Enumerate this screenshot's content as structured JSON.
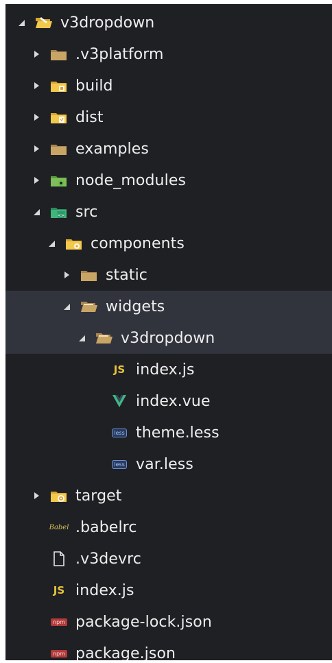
{
  "tree": [
    {
      "label": "v3dropdown",
      "depth": 0,
      "arrow": "expanded",
      "icon": "folder-open-yellow-icon"
    },
    {
      "label": ".v3platform",
      "depth": 1,
      "arrow": "collapsed",
      "icon": "folder-tan-icon"
    },
    {
      "label": "build",
      "depth": 1,
      "arrow": "collapsed",
      "icon": "folder-build-icon"
    },
    {
      "label": "dist",
      "depth": 1,
      "arrow": "collapsed",
      "icon": "folder-dist-icon"
    },
    {
      "label": "examples",
      "depth": 1,
      "arrow": "collapsed",
      "icon": "folder-tan-icon"
    },
    {
      "label": "node_modules",
      "depth": 1,
      "arrow": "collapsed",
      "icon": "folder-node-icon"
    },
    {
      "label": "src",
      "depth": 1,
      "arrow": "expanded",
      "icon": "folder-src-icon"
    },
    {
      "label": "components",
      "depth": 2,
      "arrow": "expanded",
      "icon": "folder-components-icon"
    },
    {
      "label": "static",
      "depth": 3,
      "arrow": "collapsed",
      "icon": "folder-tan-icon"
    },
    {
      "label": "widgets",
      "depth": 3,
      "arrow": "expanded",
      "icon": "folder-open-tan-icon",
      "highlight": true
    },
    {
      "label": "v3dropdown",
      "depth": 4,
      "arrow": "expanded",
      "icon": "folder-open-tan-icon",
      "highlight": true
    },
    {
      "label": "index.js",
      "depth": 5,
      "arrow": "none",
      "icon": "js-file-icon",
      "icon_text": "JS"
    },
    {
      "label": "index.vue",
      "depth": 5,
      "arrow": "none",
      "icon": "vue-file-icon"
    },
    {
      "label": "theme.less",
      "depth": 5,
      "arrow": "none",
      "icon": "less-file-icon",
      "icon_text": "less"
    },
    {
      "label": "var.less",
      "depth": 5,
      "arrow": "none",
      "icon": "less-file-icon",
      "icon_text": "less"
    },
    {
      "label": "target",
      "depth": 1,
      "arrow": "collapsed",
      "icon": "folder-target-icon"
    },
    {
      "label": ".babelrc",
      "depth": 1,
      "arrow": "none",
      "icon": "babel-file-icon",
      "icon_text": "Babel"
    },
    {
      "label": ".v3devrc",
      "depth": 1,
      "arrow": "none",
      "icon": "file-icon"
    },
    {
      "label": "index.js",
      "depth": 1,
      "arrow": "none",
      "icon": "js-file-icon",
      "icon_text": "JS"
    },
    {
      "label": "package-lock.json",
      "depth": 1,
      "arrow": "none",
      "icon": "npm-file-icon",
      "icon_text": "npm"
    },
    {
      "label": "package.json",
      "depth": 1,
      "arrow": "none",
      "icon": "npm-file-icon",
      "icon_text": "npm"
    }
  ],
  "colors": {
    "background": "#1f2024",
    "highlight_row": "#32343d",
    "text": "#eeeeee",
    "folder_tan": "#c9a565",
    "folder_yellow": "#f2c94c",
    "vue_green": "#41b883",
    "js_yellow": "#e8c33c",
    "npm_red": "#b23a3a"
  }
}
